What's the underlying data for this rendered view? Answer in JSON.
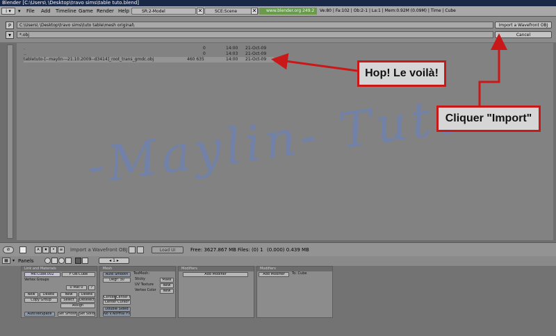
{
  "window": {
    "title": "Blender [C:\\Users\\      \\Desktop\\travo sims\\table tuto.blend]"
  },
  "infobar": {
    "menus": [
      "File",
      "Add",
      "Timeline",
      "Game",
      "Render",
      "Help"
    ],
    "screen_field": "SR:2-Model",
    "scene_field": "SCE:Scene",
    "url": "www.blender.org 249.2",
    "stats": "Ve:80 | Fa:102 | Ob:2-1 | La:1 | Mem:0.92M (0.09M) | Time | Cube"
  },
  "filebrowser": {
    "p_label": "P",
    "path": "C:\\Users\\      \\Desktop\\travo sims\\tuto table\\mesh original\\",
    "filter": "*.obj",
    "import_button": "Import a Wavefront OBJ",
    "cancel_button": "Cancel",
    "files": [
      {
        "name": ".",
        "size": "0",
        "time": "14:00",
        "date": "21-Oct-09"
      },
      {
        "name": "..",
        "size": "0",
        "time": "14:03",
        "date": "21-Oct-09"
      },
      {
        "name": "tabletuto-[--maylin---21.10.2009--d3414]_root_trans_gmdc.obj",
        "size": "460 635",
        "time": "14:00",
        "date": "21-Oct-09"
      }
    ],
    "bottom": {
      "title_label": "Import a Wavefront OBJ",
      "load_ui": "Load UI",
      "free": "Free: 3627.867 MB",
      "files": "Files: (0) 1",
      "sel": "(0.000) 0.439 MB"
    }
  },
  "annotations": {
    "callout1": "Hop! Le voilà!",
    "callout2": "Cliquer \"Import\"",
    "watermark": "-Maylin- Tuto",
    "color": "#c81818"
  },
  "buttons_window": {
    "header_label": "Panels",
    "frame": "1",
    "panel1": {
      "title": "Link and Materials",
      "me": "ME:Cube.002",
      "f": "F OB:Cube",
      "vgroups": "Vertex Groups",
      "mat": "0 Mat 0",
      "mat_q": "?",
      "new": "New",
      "delete": "Delete",
      "copy_group": "Copy Group",
      "new2": "New",
      "delete2": "Delete",
      "select": "Select",
      "deselect": "Deselect",
      "assign": "Assign",
      "autotex": "AutoTexSpace",
      "set_smooth": "Set Smooth",
      "set_solid": "Set Solid"
    },
    "panel2": {
      "title": "Mesh",
      "auto_smooth": "Auto Smooth",
      "degr": "Degr: 30",
      "center": "Center",
      "center_new": "Center New",
      "center_cursor": "Center Cursor",
      "double_sided": "Double Sided",
      "no_vnormal": "No V.Normal Flip",
      "texmesh": "TexMesh:",
      "sticky": "Sticky",
      "uv_texture": "UV Texture",
      "vertex_color": "Vertex Color",
      "make": "Make",
      "new1": "New",
      "new2": "New"
    },
    "panel3": {
      "title": "Modifiers",
      "add": "Add Modifier"
    },
    "panel4": {
      "title": "Modifiers",
      "add": "Add Modifier",
      "to": "To: Cube"
    }
  }
}
